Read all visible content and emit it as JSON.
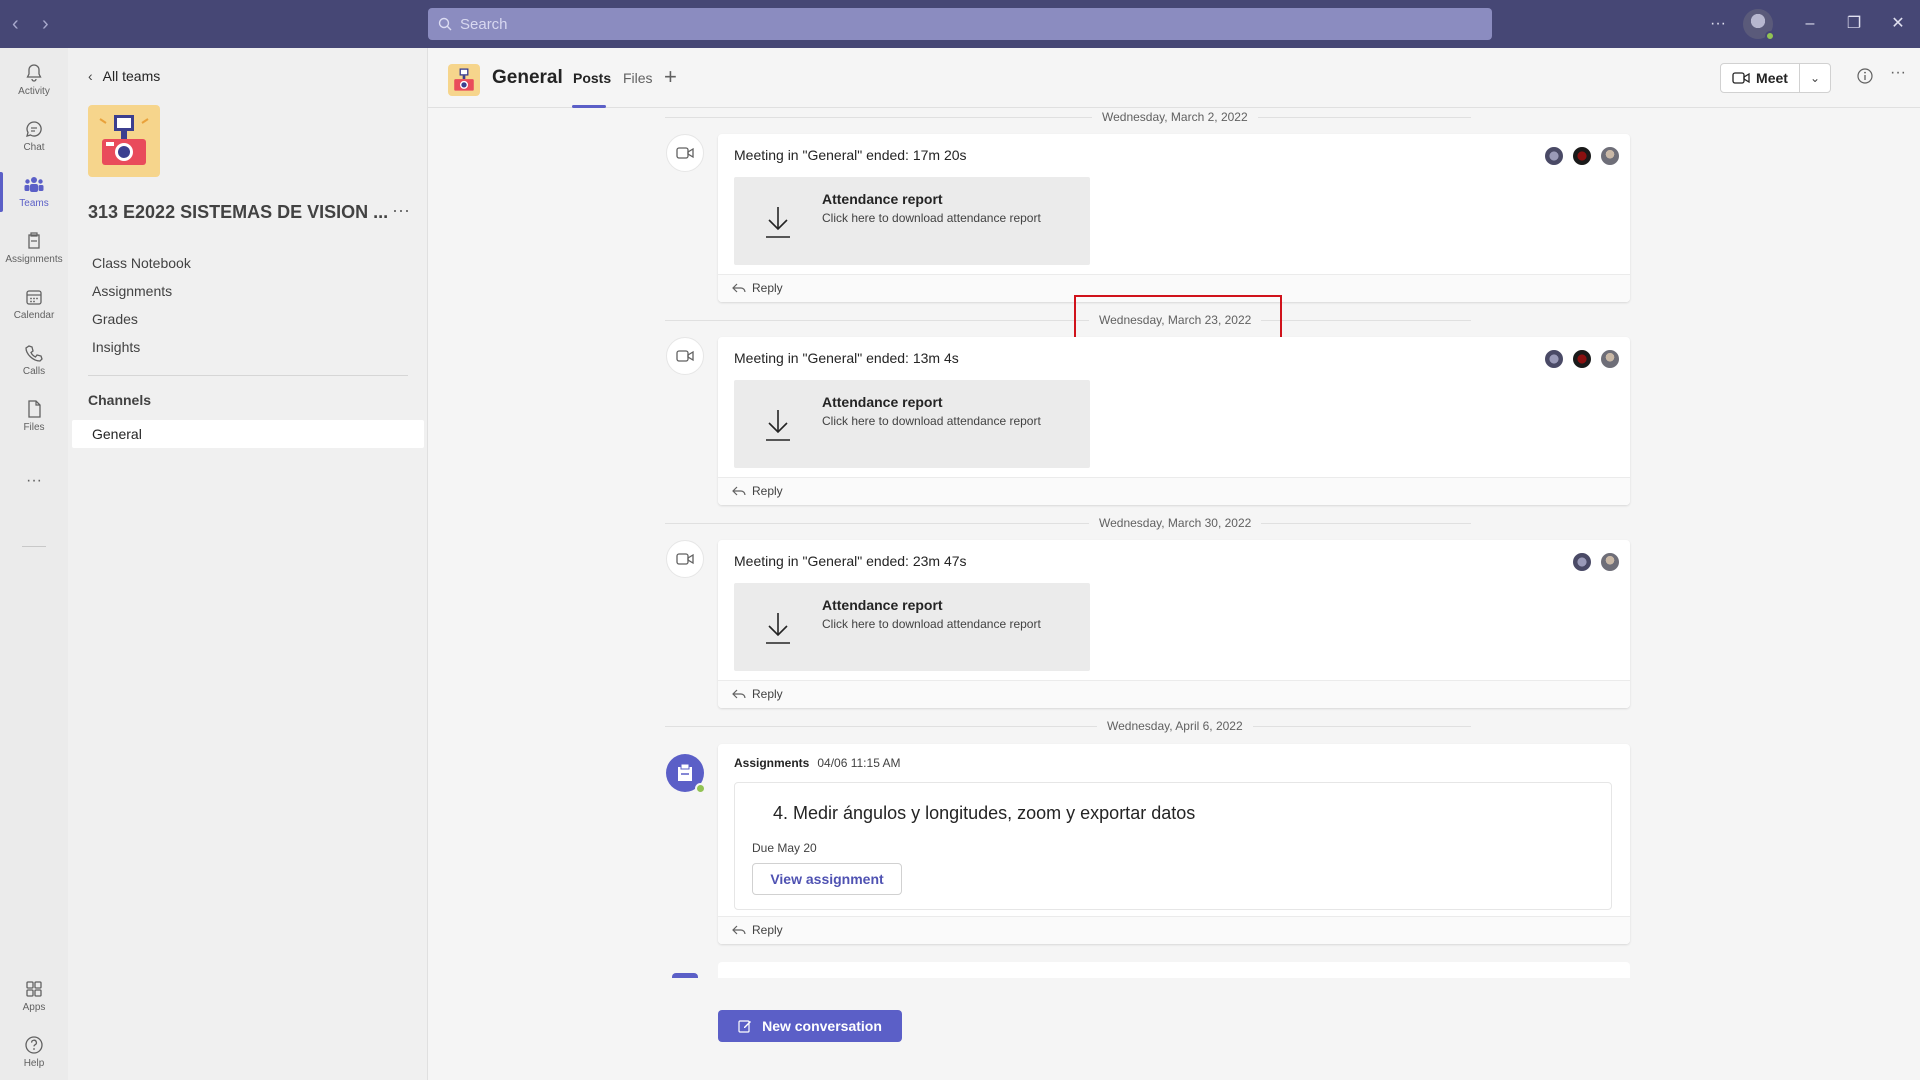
{
  "titlebar": {
    "search_placeholder": "Search",
    "more_label": "···"
  },
  "rail": {
    "items": [
      {
        "label": "Activity",
        "icon": "bell-icon"
      },
      {
        "label": "Chat",
        "icon": "chat-icon"
      },
      {
        "label": "Teams",
        "icon": "teams-icon",
        "active": true
      },
      {
        "label": "Assignments",
        "icon": "assignments-icon"
      },
      {
        "label": "Calendar",
        "icon": "calendar-icon"
      },
      {
        "label": "Calls",
        "icon": "phone-icon"
      },
      {
        "label": "Files",
        "icon": "file-icon"
      }
    ],
    "more": "···",
    "apps_label": "Apps",
    "help_label": "Help"
  },
  "team_panel": {
    "back_label": "All teams",
    "team_name": "313 E2022 SISTEMAS DE VISION ...",
    "more": "···",
    "nav": [
      "Class Notebook",
      "Assignments",
      "Grades",
      "Insights"
    ],
    "channels_heading": "Channels",
    "channels": [
      "General"
    ]
  },
  "channel_header": {
    "title": "General",
    "tabs": [
      "Posts",
      "Files"
    ],
    "active_tab": "Posts",
    "meet_label": "Meet",
    "more": "···"
  },
  "feed": {
    "date_1": "Wednesday, March 2, 2022",
    "date_2": "Wednesday, March 23, 2022",
    "date_3": "Wednesday, March 30, 2022",
    "date_4": "Wednesday, April 6, 2022",
    "meetings": [
      {
        "title": "Meeting in \"General\" ended: 17m 20s"
      },
      {
        "title": "Meeting in \"General\" ended: 13m 4s"
      },
      {
        "title": "Meeting in \"General\" ended: 23m 47s"
      }
    ],
    "attendance_title": "Attendance report",
    "attendance_sub": "Click here to download attendance report",
    "reply_label": "Reply",
    "assignment": {
      "author": "Assignments",
      "timestamp": "04/06 11:15 AM",
      "title": "4. Medir ángulos y longitudes, zoom y exportar datos",
      "due": "Due May 20",
      "button": "View assignment"
    }
  },
  "new_conversation_label": "New conversation",
  "colors": {
    "titlebar": "#464775",
    "accent": "#5b5fc7",
    "highlight": "#d0121b",
    "presence": "#92c353"
  }
}
